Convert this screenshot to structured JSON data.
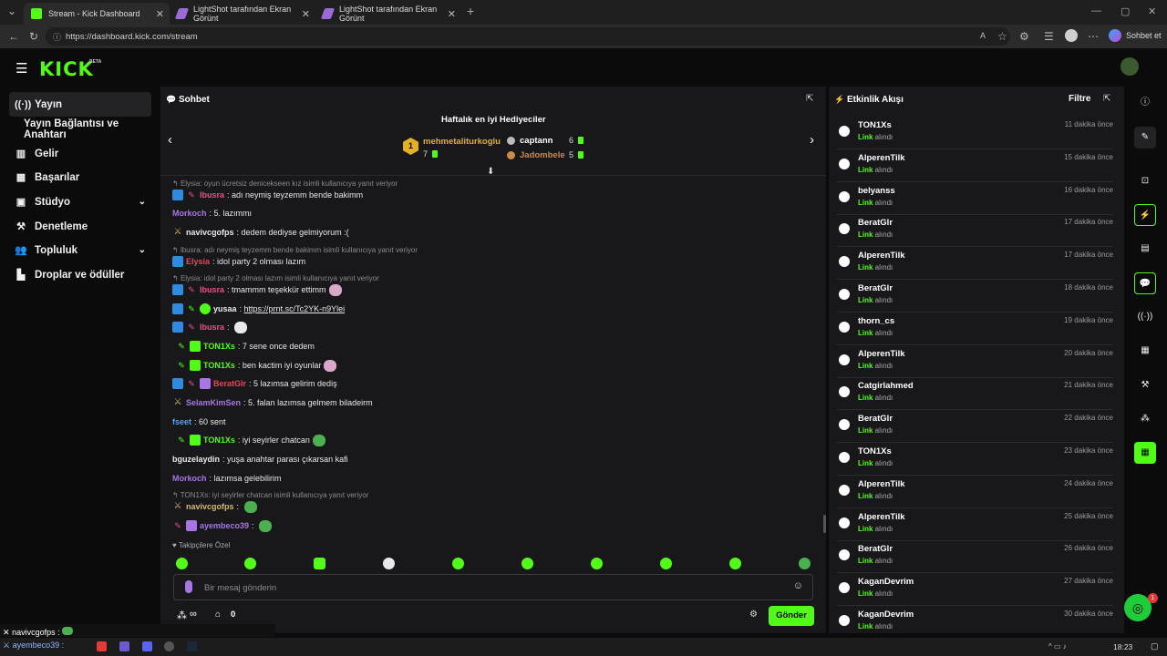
{
  "browser": {
    "tabs": [
      {
        "label": "Stream - Kick Dashboard",
        "active": true
      },
      {
        "label": "LightShot tarafından Ekran Görünt",
        "active": false
      },
      {
        "label": "LightShot tarafından Ekran Görünt",
        "active": false
      }
    ],
    "url": "https://dashboard.kick.com/stream",
    "profile_label": "Sohbet et"
  },
  "header": {
    "logo": "KICK",
    "beta": "BETA"
  },
  "nav": {
    "items": [
      {
        "label": "Yayın",
        "icon": "broadcast-icon"
      },
      {
        "label": "Yayın Bağlantısı ve Anahtarı",
        "icon": ""
      },
      {
        "label": "Gelir",
        "icon": "revenue-icon"
      },
      {
        "label": "Başarılar",
        "icon": "achievements-icon"
      },
      {
        "label": "Stüdyo",
        "icon": "studio-icon"
      },
      {
        "label": "Denetleme",
        "icon": "moderation-icon"
      },
      {
        "label": "Topluluk",
        "icon": "community-icon"
      },
      {
        "label": "Droplar ve ödüller",
        "icon": "drops-icon"
      }
    ]
  },
  "chat": {
    "title": "Sohbet",
    "gifters_title": "Haftalık en iyi Hediyeciler",
    "gifters": [
      {
        "rank": "1",
        "name": "mehmetaliturkoglu",
        "count": "7"
      },
      {
        "rank": "",
        "name": "captann",
        "count": "6"
      },
      {
        "rank": "",
        "name": "Jadombele",
        "count": "5"
      }
    ],
    "messages": [
      {
        "reply": "Elysia: oyun ücretsiz denicekseen kız isimli kullanıcıya yanıt veriyor"
      },
      {
        "user": "lbusra",
        "text": "adı neymiş teyzemm bende bakimm",
        "color": "#ec4d8b"
      },
      {
        "user": "Morkoch",
        "text": "5. lazımmı",
        "color": "#a875e5"
      },
      {
        "user": "navivcgofps",
        "text": "dedem dediyse gelmiyorum :(",
        "color": "#e8e8e8"
      },
      {
        "reply": "lbusra: adı neymiş teyzemm bende bakimm isimli kullanıcıya yanıt veriyor"
      },
      {
        "user": "Elysia",
        "text": "idol party 2 olması lazım",
        "color": "#e8445a"
      },
      {
        "reply": "Elysia: idol party 2 olması lazım isimli kullanıcıya yanıt veriyor"
      },
      {
        "user": "lbusra",
        "text": "tmammm teşekkür ettimm",
        "color": "#ec4d8b"
      },
      {
        "user": "yusaa",
        "text": "https://prnt.sc/Tc2YK-n9Ylei",
        "color": "#e8e8e8"
      },
      {
        "user": "lbusra",
        "text": "",
        "color": "#ec4d8b"
      },
      {
        "user": "TON1Xs",
        "text": "7 sene once dedem",
        "color": "#53fc18"
      },
      {
        "user": "TON1Xs",
        "text": "ben kactim iyi oyunlar",
        "color": "#53fc18"
      },
      {
        "user": "BeratGlr",
        "text": "5 lazımsa gelirim dediş",
        "color": "#e8445a"
      },
      {
        "user": "SelamKimSen",
        "text": "5. falan lazımsa gelmem biladeirm",
        "color": "#a875e5"
      },
      {
        "user": "fseet",
        "text": "60 sent",
        "color": "#5c9ff0"
      },
      {
        "user": "TON1Xs",
        "text": "iyi seyirler chatcan",
        "color": "#53fc18"
      },
      {
        "user": "bguzelaydin",
        "text": "yuşa anahtar parası çıkarsan kafi",
        "color": "#e8e8e8"
      },
      {
        "user": "Morkoch",
        "text": "lazımsa gelebilirim",
        "color": "#a875e5"
      },
      {
        "reply": "TON1Xs: iyi seyirler chatcan isimli kullanıcıya yanıt veriyor"
      },
      {
        "user": "navivcgofps",
        "text": "",
        "color": "#d8b96a"
      },
      {
        "user": "ayembeco39",
        "text": "",
        "color": "#a875e5"
      }
    ],
    "followers_only": "Takipçilere Özel",
    "input_placeholder": "Bir mesaj gönderin",
    "stats": {
      "infinity": "∞",
      "count": "0"
    },
    "send_label": "Gönder"
  },
  "activity": {
    "title": "Etkinlik Akışı",
    "filter_label": "Filtre",
    "desc_link": "Link",
    "desc_rest": " alındı",
    "items": [
      {
        "name": "TON1Xs",
        "time": "11 dakika önce"
      },
      {
        "name": "AlperenTilk",
        "time": "15 dakika önce"
      },
      {
        "name": "belyanss",
        "time": "16 dakika önce"
      },
      {
        "name": "BeratGlr",
        "time": "17 dakika önce"
      },
      {
        "name": "AlperenTilk",
        "time": "17 dakika önce"
      },
      {
        "name": "BeratGlr",
        "time": "18 dakika önce"
      },
      {
        "name": "thorn_cs",
        "time": "19 dakika önce"
      },
      {
        "name": "AlperenTilk",
        "time": "20 dakika önce"
      },
      {
        "name": "Catgirlahmed",
        "time": "21 dakika önce"
      },
      {
        "name": "BeratGlr",
        "time": "22 dakika önce"
      },
      {
        "name": "TON1Xs",
        "time": "23 dakika önce"
      },
      {
        "name": "AlperenTilk",
        "time": "24 dakika önce"
      },
      {
        "name": "AlperenTilk",
        "time": "25 dakika önce"
      },
      {
        "name": "BeratGlr",
        "time": "26 dakika önce"
      },
      {
        "name": "KaganDevrim",
        "time": "27 dakika önce"
      },
      {
        "name": "KaganDevrim",
        "time": "30 dakika önce"
      }
    ]
  },
  "overlay": {
    "line1": "navivcgofps :",
    "line2": "ayembeco39 :"
  },
  "help_badge": "1",
  "taskbar": {
    "time": "18:23"
  },
  "colors": {
    "accent": "#53fc18",
    "panel": "#18181b",
    "background": "#0b0b0c"
  }
}
